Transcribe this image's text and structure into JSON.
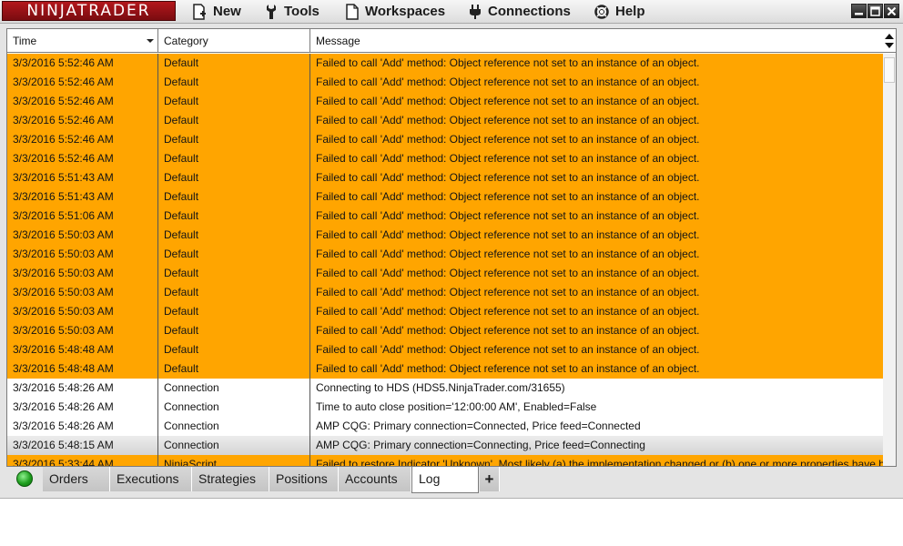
{
  "app": {
    "logo": "NINJATRADER",
    "menu": {
      "new": "New",
      "tools": "Tools",
      "workspaces": "Workspaces",
      "connections": "Connections",
      "help": "Help"
    }
  },
  "grid": {
    "columns": [
      "Time",
      "Category",
      "Message"
    ],
    "rows": [
      {
        "time": "3/3/2016 5:52:46 AM",
        "category": "Default",
        "message": "Failed to call 'Add' method: Object reference not set to an instance of an object.",
        "style": "orange"
      },
      {
        "time": "3/3/2016 5:52:46 AM",
        "category": "Default",
        "message": "Failed to call 'Add' method: Object reference not set to an instance of an object.",
        "style": "orange"
      },
      {
        "time": "3/3/2016 5:52:46 AM",
        "category": "Default",
        "message": "Failed to call 'Add' method: Object reference not set to an instance of an object.",
        "style": "orange"
      },
      {
        "time": "3/3/2016 5:52:46 AM",
        "category": "Default",
        "message": "Failed to call 'Add' method: Object reference not set to an instance of an object.",
        "style": "orange"
      },
      {
        "time": "3/3/2016 5:52:46 AM",
        "category": "Default",
        "message": "Failed to call 'Add' method: Object reference not set to an instance of an object.",
        "style": "orange"
      },
      {
        "time": "3/3/2016 5:52:46 AM",
        "category": "Default",
        "message": "Failed to call 'Add' method: Object reference not set to an instance of an object.",
        "style": "orange"
      },
      {
        "time": "3/3/2016 5:51:43 AM",
        "category": "Default",
        "message": "Failed to call 'Add' method: Object reference not set to an instance of an object.",
        "style": "orange"
      },
      {
        "time": "3/3/2016 5:51:43 AM",
        "category": "Default",
        "message": "Failed to call 'Add' method: Object reference not set to an instance of an object.",
        "style": "orange"
      },
      {
        "time": "3/3/2016 5:51:06 AM",
        "category": "Default",
        "message": "Failed to call 'Add' method: Object reference not set to an instance of an object.",
        "style": "orange"
      },
      {
        "time": "3/3/2016 5:50:03 AM",
        "category": "Default",
        "message": "Failed to call 'Add' method: Object reference not set to an instance of an object.",
        "style": "orange"
      },
      {
        "time": "3/3/2016 5:50:03 AM",
        "category": "Default",
        "message": "Failed to call 'Add' method: Object reference not set to an instance of an object.",
        "style": "orange"
      },
      {
        "time": "3/3/2016 5:50:03 AM",
        "category": "Default",
        "message": "Failed to call 'Add' method: Object reference not set to an instance of an object.",
        "style": "orange"
      },
      {
        "time": "3/3/2016 5:50:03 AM",
        "category": "Default",
        "message": "Failed to call 'Add' method: Object reference not set to an instance of an object.",
        "style": "orange"
      },
      {
        "time": "3/3/2016 5:50:03 AM",
        "category": "Default",
        "message": "Failed to call 'Add' method: Object reference not set to an instance of an object.",
        "style": "orange"
      },
      {
        "time": "3/3/2016 5:50:03 AM",
        "category": "Default",
        "message": "Failed to call 'Add' method: Object reference not set to an instance of an object.",
        "style": "orange"
      },
      {
        "time": "3/3/2016 5:48:48 AM",
        "category": "Default",
        "message": "Failed to call 'Add' method: Object reference not set to an instance of an object.",
        "style": "orange"
      },
      {
        "time": "3/3/2016 5:48:48 AM",
        "category": "Default",
        "message": "Failed to call 'Add' method: Object reference not set to an instance of an object.",
        "style": "orange"
      },
      {
        "time": "3/3/2016 5:48:26 AM",
        "category": "Connection",
        "message": "Connecting to HDS (HDS5.NinjaTrader.com/31655)",
        "style": "white"
      },
      {
        "time": "3/3/2016 5:48:26 AM",
        "category": "Connection",
        "message": "Time to auto close position='12:00:00 AM', Enabled=False",
        "style": "white"
      },
      {
        "time": "3/3/2016 5:48:26 AM",
        "category": "Connection",
        "message": "AMP CQG: Primary connection=Connected, Price feed=Connected",
        "style": "white"
      },
      {
        "time": "3/3/2016 5:48:15 AM",
        "category": "Connection",
        "message": "AMP CQG: Primary connection=Connecting, Price feed=Connecting",
        "style": "selected"
      },
      {
        "time": "3/3/2016 5:33:44 AM",
        "category": "NinjaScript",
        "message": "Failed to restore Indicator 'Unknown'. Most likely (a) the implementation changed or (b) one or more properties have been renamed or removed",
        "style": "orange"
      }
    ]
  },
  "tabs": [
    "Orders",
    "Executions",
    "Strategies",
    "Positions",
    "Accounts",
    "Log"
  ],
  "tab_add_label": "+",
  "active_tab": "Log",
  "connection_status_color": "#1f9f1f",
  "colors": {
    "error_row": "#ffa500",
    "logo_bg": "#9b1216"
  }
}
